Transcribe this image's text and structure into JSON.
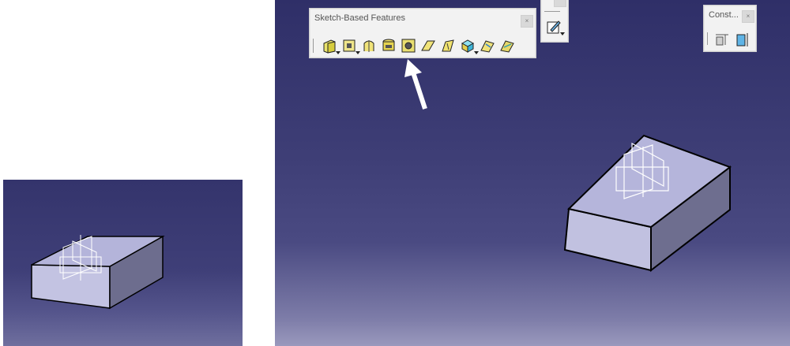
{
  "sketch_toolbar": {
    "title": "Sketch-Based Features",
    "tools": [
      {
        "icon": "pad-icon",
        "has_dropdown": true
      },
      {
        "icon": "pocket-icon",
        "has_dropdown": true
      },
      {
        "icon": "shaft-icon",
        "has_dropdown": false
      },
      {
        "icon": "groove-icon",
        "has_dropdown": false
      },
      {
        "icon": "hole-icon",
        "has_dropdown": false
      },
      {
        "icon": "rib-icon",
        "has_dropdown": false
      },
      {
        "icon": "slot-icon",
        "has_dropdown": false
      },
      {
        "icon": "solid-combine-icon",
        "has_dropdown": true
      },
      {
        "icon": "multi-sections-solid-icon",
        "has_dropdown": false
      },
      {
        "icon": "removed-multi-sections-solid-icon",
        "has_dropdown": false
      }
    ],
    "highlighted_tool": "hole-icon"
  },
  "sketcher_toolbar": {
    "title": "",
    "tool_icon": "sketcher-icon"
  },
  "constraint_toolbar": {
    "title": "Const...",
    "tool_icons": [
      "constraint-icon",
      "constraint-defined-in-dialog-icon"
    ]
  },
  "annotation": {
    "arrow_icon": "pointer-arrow-icon",
    "color": "#ffffff"
  },
  "colors": {
    "viewport_top": "#2f2f68",
    "viewport_bottom": "#9a99bd",
    "part_face": "#b7b7dd",
    "part_side": "#6f6f90"
  }
}
